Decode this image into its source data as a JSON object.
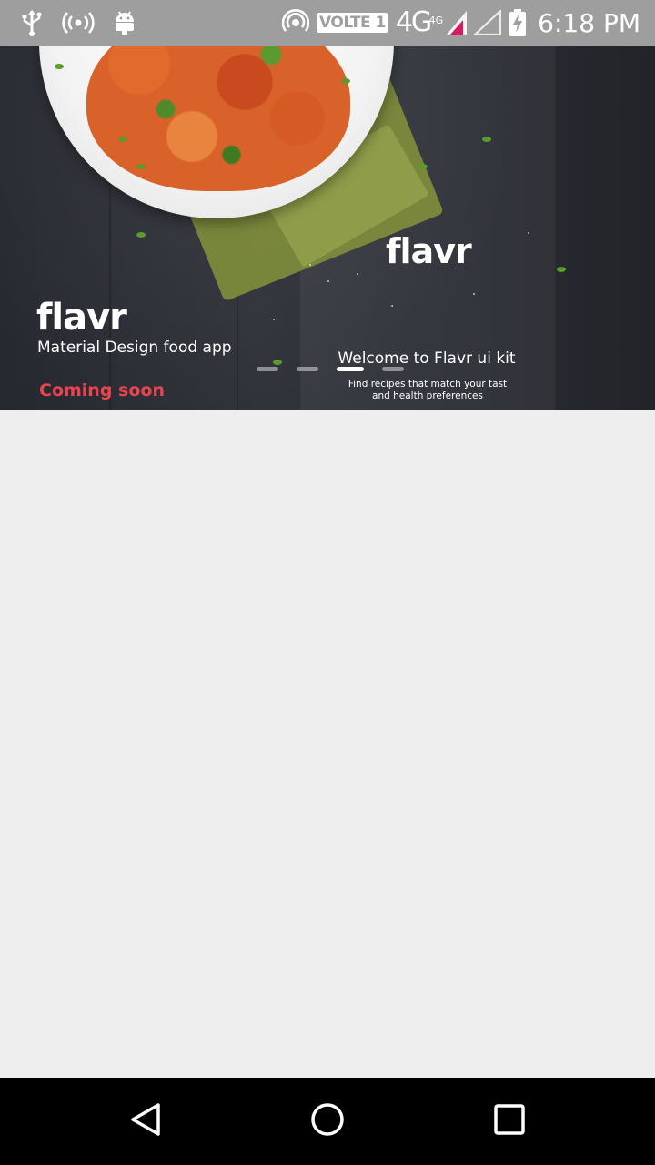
{
  "status_bar": {
    "volte_label": "VOLTE 1",
    "network_label": "4G",
    "network_sup": "4G",
    "time": "6:18 PM",
    "icons": [
      "usb-icon",
      "hotspot-icon",
      "android-debug-icon",
      "wifi-calling-icon",
      "signal-icon",
      "no-signal-icon",
      "battery-charging-icon"
    ],
    "accent_signal_color": "#d81b60"
  },
  "banner": {
    "left_brand": "flavr",
    "left_tagline": "Material Design food app",
    "coming_soon": "Coming soon",
    "right_brand": "flavr",
    "welcome_title": "Welcome to Flavr ui kit",
    "welcome_subtitle_line1": "Find recipes that match your tast",
    "welcome_subtitle_line2": "and health preferences",
    "accent_color": "#e9454f",
    "page_indicator": {
      "count": 4,
      "active_index": 2
    }
  },
  "nav_bar": {
    "buttons": [
      "back-icon",
      "home-icon",
      "recents-icon"
    ]
  }
}
